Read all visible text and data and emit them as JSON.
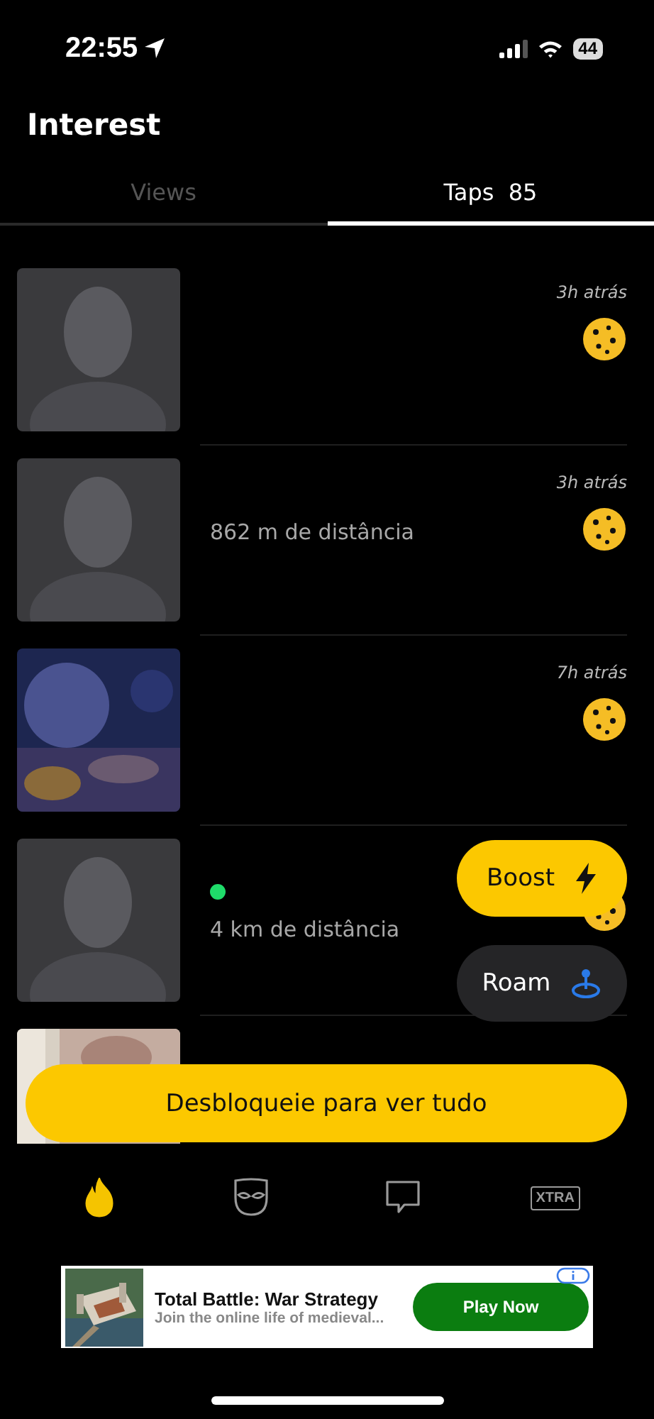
{
  "status_bar": {
    "time": "22:55",
    "battery": "44"
  },
  "title": "Interest",
  "tabs": [
    {
      "label": "Views",
      "selected": false
    },
    {
      "label": "Taps",
      "count": "85",
      "selected": true
    }
  ],
  "rows": [
    {
      "time": "3h atrás",
      "online": false
    },
    {
      "time": "3h atrás",
      "distance": "862 m de distância",
      "online": false
    },
    {
      "time": "7h atrás",
      "online": false
    },
    {
      "distance": "4 km de distância",
      "online": true
    },
    {
      "online": false
    }
  ],
  "floating_buttons": [
    {
      "kind": "boost",
      "label": "Boost"
    },
    {
      "kind": "roam",
      "label": "Roam"
    }
  ],
  "unlock_button": "Desbloqueie para ver tudo",
  "nav": [
    {
      "kind": "flame",
      "selected": true
    },
    {
      "kind": "mask",
      "selected": false
    },
    {
      "kind": "chat",
      "selected": false
    },
    {
      "kind": "xtra",
      "label": "XTRA",
      "selected": false
    }
  ],
  "ad": {
    "title": "Total Battle: War Strategy",
    "subtitle": "Join the online life of medieval...",
    "button": "Play Now"
  }
}
